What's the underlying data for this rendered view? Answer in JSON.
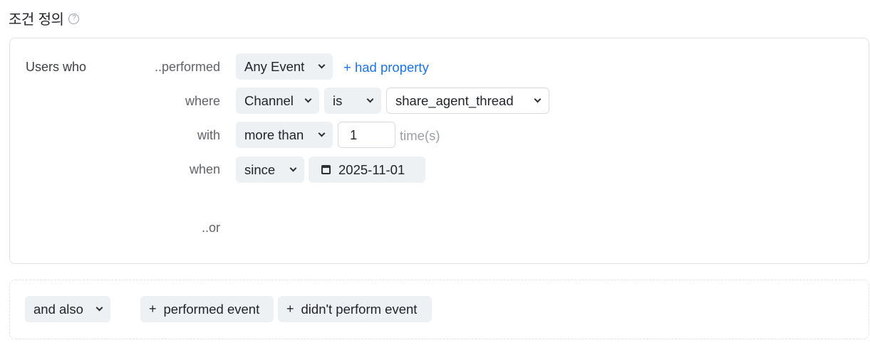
{
  "header": {
    "title": "조건 정의",
    "help_glyph": "?"
  },
  "condition": {
    "users_who": "Users who",
    "performed_label": "..performed",
    "event_select": "Any Event",
    "had_property": "+ had property",
    "where_label": "where",
    "property_select": "Channel",
    "operator_select": "is",
    "value_select": "share_agent_thread",
    "with_label": "with",
    "frequency_select": "more than",
    "count_value": "1",
    "count_unit": "time(s)",
    "when_label": "when",
    "time_select": "since",
    "date_value": "2025-11-01",
    "or_label": "..or"
  },
  "footer": {
    "and_also": "and also",
    "plus": "+",
    "performed_event": "performed event",
    "didnt_perform_event": "didn't perform event"
  },
  "colors": {
    "link": "#1a73e8",
    "chip_bg": "#eef1f4",
    "border": "#dfe3e8"
  }
}
